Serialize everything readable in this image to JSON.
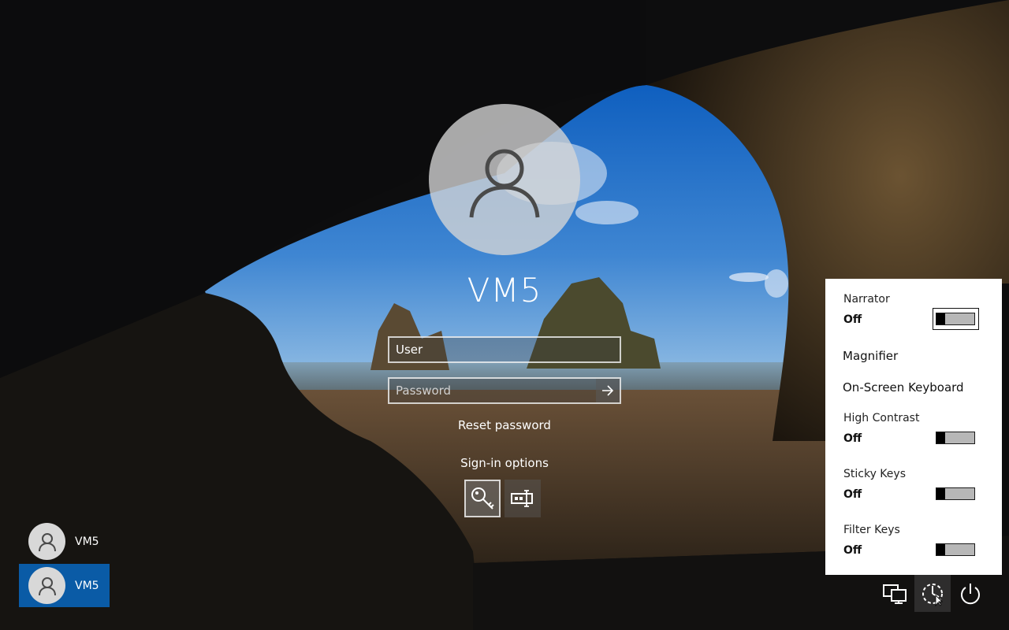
{
  "user": {
    "display_name": "VM5"
  },
  "username_field": {
    "value": "User"
  },
  "password_field": {
    "placeholder": "Password"
  },
  "links": {
    "reset_password": "Reset password",
    "signin_options": "Sign-in options"
  },
  "user_list": [
    {
      "name": "VM5",
      "selected": false
    },
    {
      "name": "VM5",
      "selected": true
    }
  ],
  "ease_of_access": {
    "narrator": {
      "label": "Narrator",
      "state": "Off"
    },
    "magnifier": {
      "label": "Magnifier"
    },
    "onscreen_keyboard": {
      "label": "On-Screen Keyboard"
    },
    "high_contrast": {
      "label": "High Contrast",
      "state": "Off"
    },
    "sticky_keys": {
      "label": "Sticky Keys",
      "state": "Off"
    },
    "filter_keys": {
      "label": "Filter Keys",
      "state": "Off"
    }
  },
  "icons": {
    "submit": "arrow-right-icon",
    "key": "key-icon",
    "pin": "pin-pad-icon",
    "network": "network-icon",
    "ease": "ease-of-access-icon",
    "power": "power-icon"
  },
  "colors": {
    "selected_user": "#0a5ba6",
    "panel_bg": "#ffffff"
  }
}
